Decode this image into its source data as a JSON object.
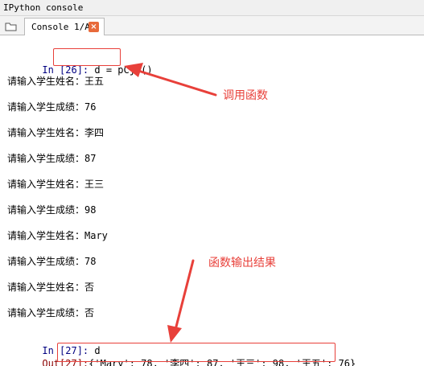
{
  "window": {
    "title": "IPython console"
  },
  "tab": {
    "label": "Console 1/A",
    "close_glyph": "×"
  },
  "console": {
    "in26_prompt": "In [26]:",
    "in26_code": "d = pCjb()",
    "lines": [
      "请输入学生姓名：王五",
      "请输入学生成绩：76",
      "请输入学生姓名：李四",
      "请输入学生成绩：87",
      "请输入学生姓名：王三",
      "请输入学生成绩：98",
      "请输入学生姓名：Mary",
      "请输入学生成绩：78",
      "请输入学生姓名：否",
      "请输入学生成绩：否"
    ],
    "in27_prompt": "In [27]:",
    "in27_code": "d",
    "out27_prompt": "Out[27]:",
    "out27_value": "{'Mary': 78, '李四': 87, '王三': 98, '王五': 76}"
  },
  "annotations": {
    "call_function": "调用函数",
    "function_output": "函数输出结果",
    "color": "#e8403a"
  },
  "icons": {
    "tab_menu": "tab-menu-icon",
    "tab_close": "close-icon"
  }
}
